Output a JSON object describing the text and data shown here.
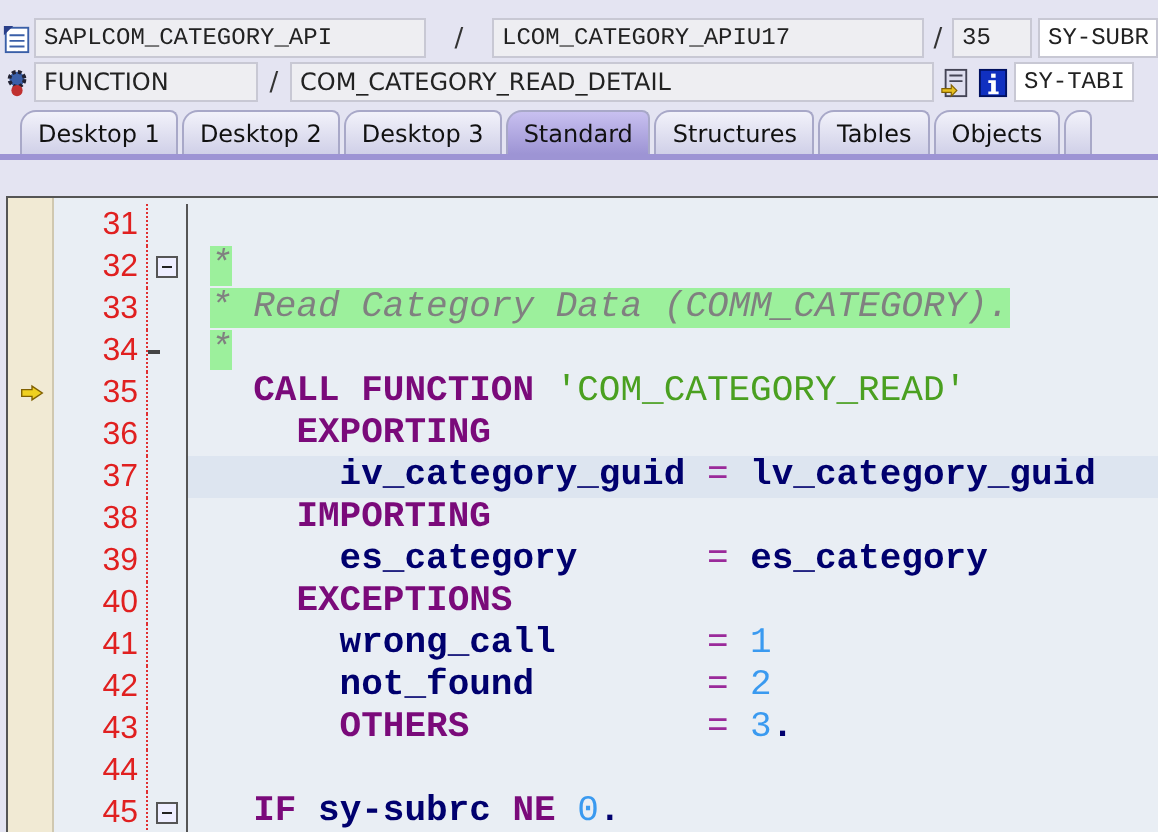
{
  "header": {
    "row1": {
      "program": "SAPLCOM_CATEGORY_API",
      "include": "LCOM_CATEGORY_APIU17",
      "line": "35",
      "field": "SY-SUBR",
      "separators": [
        "/",
        "/"
      ]
    },
    "row2": {
      "type": "FUNCTION",
      "name": "COM_CATEGORY_READ_DETAIL",
      "field": "SY-TABI",
      "separators": [
        "/"
      ]
    }
  },
  "tabs": [
    {
      "label": "Desktop 1",
      "selected": false
    },
    {
      "label": "Desktop 2",
      "selected": false
    },
    {
      "label": "Desktop 3",
      "selected": false
    },
    {
      "label": "Standard",
      "selected": true
    },
    {
      "label": "Structures",
      "selected": false
    },
    {
      "label": "Tables",
      "selected": false
    },
    {
      "label": "Objects",
      "selected": false
    }
  ],
  "lines": [
    {
      "number": "31",
      "collapsible": false,
      "block_end": false,
      "current": false,
      "selected": false
    },
    {
      "number": "32",
      "collapsible": true,
      "block_end": false,
      "current": false,
      "selected": false,
      "tokens": [
        {
          "kind": "comment",
          "text": "*"
        }
      ]
    },
    {
      "number": "33",
      "collapsible": false,
      "block_end": false,
      "current": false,
      "selected": false,
      "tokens": [
        {
          "kind": "comment",
          "text": "* Read Category Data (COMM_CATEGORY)."
        }
      ]
    },
    {
      "number": "34",
      "collapsible": false,
      "block_end": true,
      "current": false,
      "selected": false,
      "tokens": [
        {
          "kind": "comment",
          "text": "*"
        }
      ]
    },
    {
      "number": "35",
      "collapsible": false,
      "block_end": false,
      "current": true,
      "selected": false,
      "tokens": [
        {
          "kind": "keyword",
          "text": "  CALL FUNCTION"
        },
        {
          "kind": "string",
          "text": " 'COM_CATEGORY_READ'"
        }
      ]
    },
    {
      "number": "36",
      "collapsible": false,
      "block_end": false,
      "current": false,
      "selected": false,
      "tokens": [
        {
          "kind": "keyword",
          "text": "    EXPORTING"
        }
      ]
    },
    {
      "number": "37",
      "collapsible": false,
      "block_end": false,
      "current": false,
      "selected": true,
      "tokens": [
        {
          "kind": "ident",
          "text": "      iv_category_guid"
        },
        {
          "kind": "op",
          "text": " ="
        },
        {
          "kind": "ident",
          "text": " lv_category_guid"
        }
      ]
    },
    {
      "number": "38",
      "collapsible": false,
      "block_end": false,
      "current": false,
      "selected": false,
      "tokens": [
        {
          "kind": "keyword",
          "text": "    IMPORTING"
        }
      ]
    },
    {
      "number": "39",
      "collapsible": false,
      "block_end": false,
      "current": false,
      "selected": false,
      "tokens": [
        {
          "kind": "ident",
          "text": "      es_category"
        },
        {
          "kind": "op",
          "text": "      ="
        },
        {
          "kind": "ident",
          "text": " es_category"
        }
      ]
    },
    {
      "number": "40",
      "collapsible": false,
      "block_end": false,
      "current": false,
      "selected": false,
      "tokens": [
        {
          "kind": "keyword",
          "text": "    EXCEPTIONS"
        }
      ]
    },
    {
      "number": "41",
      "collapsible": false,
      "block_end": false,
      "current": false,
      "selected": false,
      "tokens": [
        {
          "kind": "ident",
          "text": "      wrong_call"
        },
        {
          "kind": "op",
          "text": "       ="
        },
        {
          "kind": "number",
          "text": " 1"
        }
      ]
    },
    {
      "number": "42",
      "collapsible": false,
      "block_end": false,
      "current": false,
      "selected": false,
      "tokens": [
        {
          "kind": "ident",
          "text": "      not_found"
        },
        {
          "kind": "op",
          "text": "        ="
        },
        {
          "kind": "number",
          "text": " 2"
        }
      ]
    },
    {
      "number": "43",
      "collapsible": false,
      "block_end": false,
      "current": false,
      "selected": false,
      "tokens": [
        {
          "kind": "keyword",
          "text": "      OTHERS"
        },
        {
          "kind": "op",
          "text": "           ="
        },
        {
          "kind": "number",
          "text": " 3"
        },
        {
          "kind": "ident",
          "text": "."
        }
      ]
    },
    {
      "number": "44",
      "collapsible": false,
      "block_end": false,
      "current": false,
      "selected": false
    },
    {
      "number": "45",
      "collapsible": true,
      "block_end": false,
      "current": false,
      "selected": false,
      "tokens": [
        {
          "kind": "keyword",
          "text": "  IF"
        },
        {
          "kind": "ident",
          "text": " sy-subrc"
        },
        {
          "kind": "keyword",
          "text": " NE"
        },
        {
          "kind": "number",
          "text": " 0"
        },
        {
          "kind": "ident",
          "text": "."
        }
      ]
    }
  ]
}
